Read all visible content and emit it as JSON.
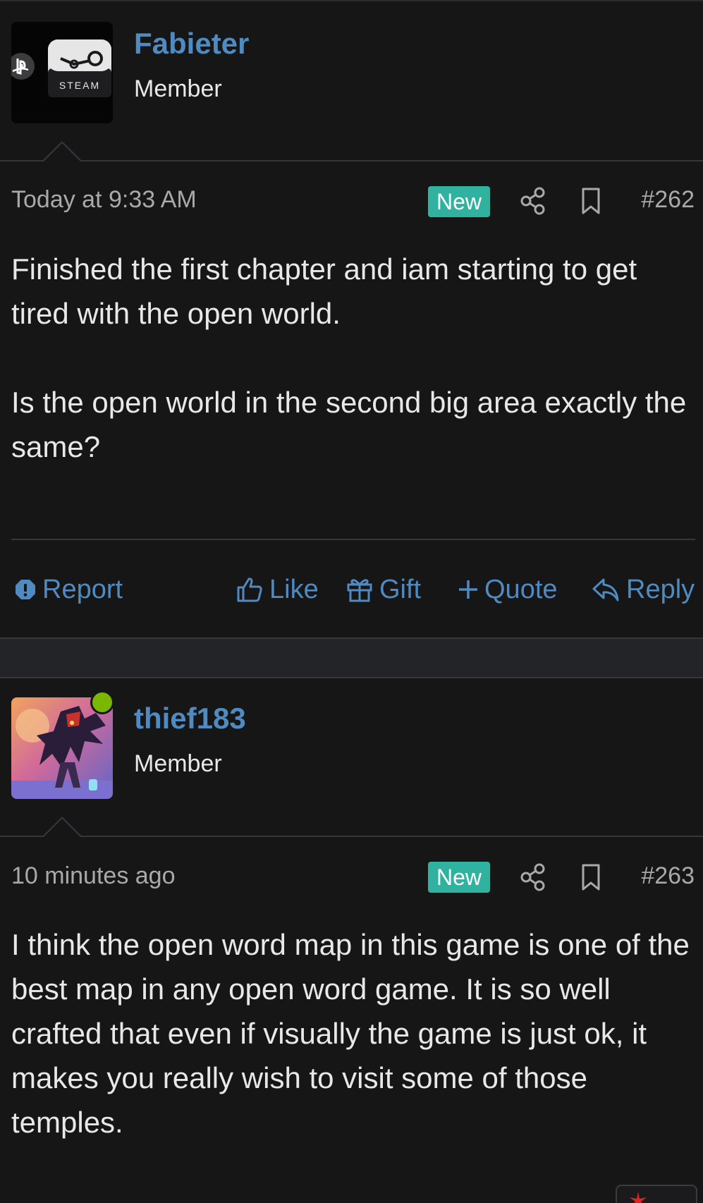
{
  "posts": [
    {
      "username": "Fabieter",
      "user_title": "Member",
      "avatar": "steam-playstation-logo",
      "avatar_text": "STEAM",
      "online": false,
      "time": "Today at 9:33 AM",
      "badge": "New",
      "number": "#262",
      "body": [
        "Finished the first chapter and iam starting to get tired with the open world.",
        "Is the open world in the second big area exactly the same?"
      ],
      "actions": {
        "report": "Report",
        "like": "Like",
        "gift": "Gift",
        "quote": "Quote",
        "reply": "Reply"
      }
    },
    {
      "username": "thief183",
      "user_title": "Member",
      "avatar": "game-character-art",
      "online": true,
      "time": "10 minutes ago",
      "badge": "New",
      "number": "#263",
      "body": [
        "I think the open word map in this game is one of the best map in any open word game. It is so well crafted that even if visually the game is just ok, it makes you really wish to visit some of those temples."
      ]
    }
  ],
  "colors": {
    "background": "#161617",
    "link": "#4f8ac0",
    "badge_new": "#2fb3a0",
    "online": "#7ab800",
    "muted_text": "#a9a9aa"
  },
  "icons": [
    "share-icon",
    "bookmark-icon",
    "report-icon",
    "like-icon",
    "gift-icon",
    "quote-icon",
    "reply-icon"
  ]
}
